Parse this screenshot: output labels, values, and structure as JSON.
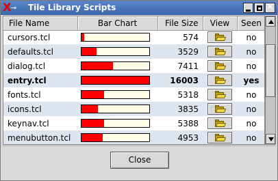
{
  "window": {
    "title": "Tile Library Scripts"
  },
  "columns": {
    "name": "File Name",
    "bar": "Bar Chart",
    "size": "File Size",
    "view": "View",
    "seen": "Seen"
  },
  "max_size": 16003,
  "rows": [
    {
      "name": "cursors.tcl",
      "size": "574",
      "seen": "no",
      "bold": false
    },
    {
      "name": "defaults.tcl",
      "size": "3529",
      "seen": "no",
      "bold": false
    },
    {
      "name": "dialog.tcl",
      "size": "7411",
      "seen": "no",
      "bold": false
    },
    {
      "name": "entry.tcl",
      "size": "16003",
      "seen": "yes",
      "bold": true
    },
    {
      "name": "fonts.tcl",
      "size": "5318",
      "seen": "no",
      "bold": false
    },
    {
      "name": "icons.tcl",
      "size": "3835",
      "seen": "no",
      "bold": false
    },
    {
      "name": "keynav.tcl",
      "size": "5388",
      "seen": "no",
      "bold": false
    },
    {
      "name": "menubutton.tcl",
      "size": "4953",
      "seen": "no",
      "bold": false
    }
  ],
  "icons": {
    "title": "tk-x-icon",
    "view": "folder-open-icon"
  },
  "buttons": {
    "close": "Close"
  },
  "colors": {
    "bar_fill": "#ff0000",
    "bar_track": "#fffde8",
    "row_alt": "#dde5f0",
    "titlebar": "#4a76ba"
  }
}
